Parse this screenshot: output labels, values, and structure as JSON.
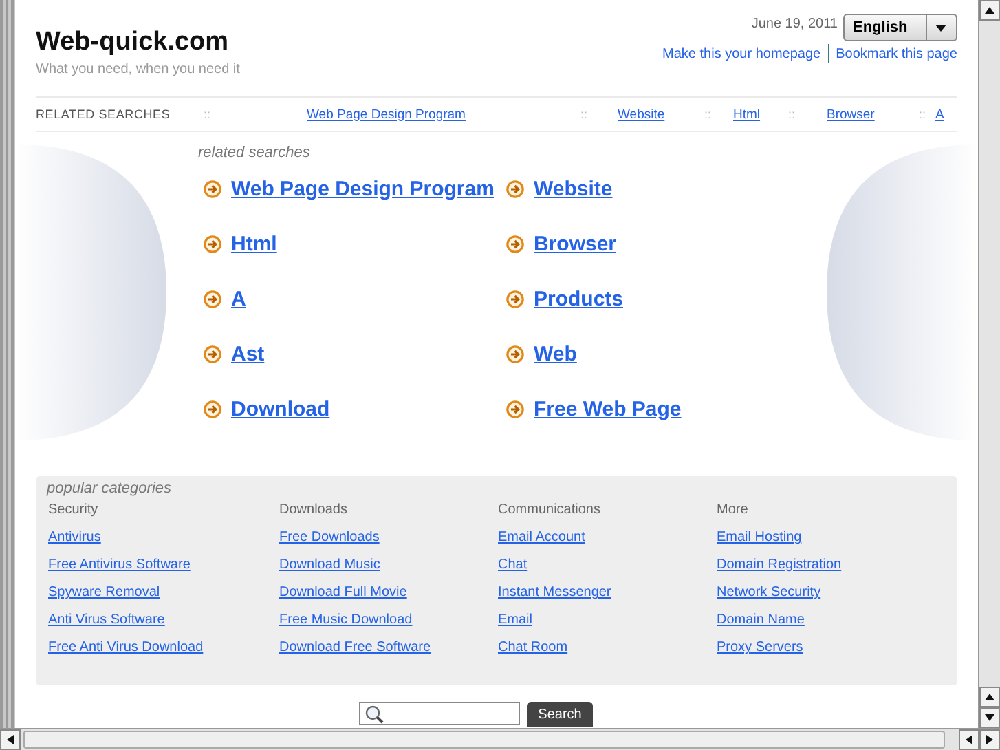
{
  "header": {
    "title": "Web-quick.com",
    "tagline": "What you need, when you need it",
    "date": "June 19, 2011",
    "language": "English",
    "links": [
      "Make this your homepage",
      "Bookmark this page"
    ]
  },
  "related_bar": {
    "label": "RELATED SEARCHES",
    "separator": "::",
    "links": [
      "Web Page Design Program",
      "Website",
      "Html",
      "Browser",
      "A"
    ]
  },
  "related_searches": {
    "heading": "related searches",
    "links": [
      "Web Page Design Program",
      "Website",
      "Html",
      "Browser",
      "A",
      "Products",
      "Ast",
      "Web",
      "Download",
      "Free Web Page"
    ]
  },
  "popular_categories": {
    "heading": "popular categories",
    "columns": [
      {
        "title": "Security",
        "links": [
          "Antivirus",
          "Free Antivirus Software",
          "Spyware Removal",
          "Anti Virus Software",
          "Free Anti Virus Download"
        ]
      },
      {
        "title": "Downloads",
        "links": [
          "Free Downloads",
          "Download Music",
          "Download Full Movie",
          "Free Music Download",
          "Download Free Software"
        ]
      },
      {
        "title": "Communications",
        "links": [
          "Email Account",
          "Chat",
          "Instant Messenger",
          "Email",
          "Chat Room"
        ]
      },
      {
        "title": "More",
        "links": [
          "Email Hosting",
          "Domain Registration",
          "Network Security",
          "Domain Name",
          "Proxy Servers"
        ]
      }
    ]
  },
  "search": {
    "button": "Search"
  }
}
